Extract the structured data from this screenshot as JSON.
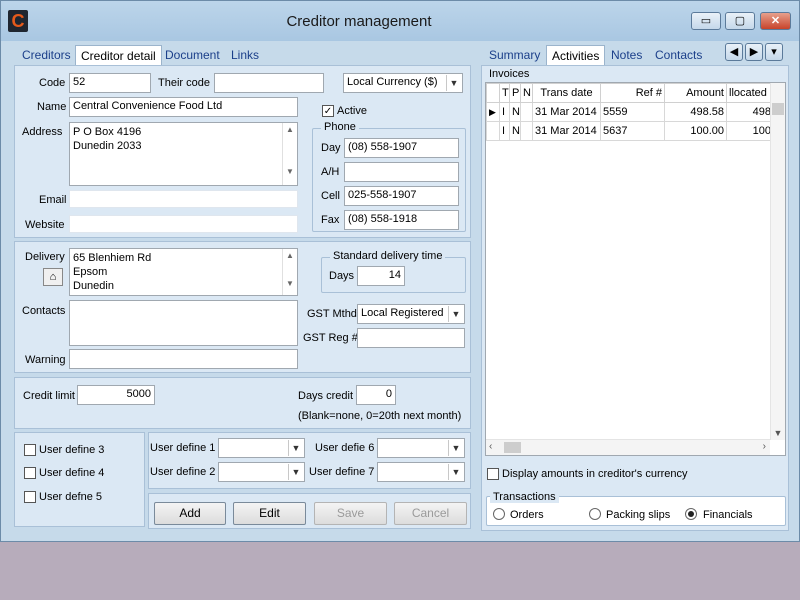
{
  "window": {
    "title": "Creditor management",
    "icon_letter": "C",
    "minimize_symbol": "▭",
    "maximize_symbol": "▢",
    "close_symbol": "✕"
  },
  "left_tabs": [
    "Creditors",
    "Creditor detail",
    "Document",
    "Links"
  ],
  "right_tabs": [
    "Summary",
    "Activities",
    "Notes",
    "Contacts"
  ],
  "nav_buttons": [
    "◀",
    "▶",
    "▾"
  ],
  "details": {
    "code_label": "Code",
    "code_value": "52",
    "their_code_label": "Their code",
    "their_code_value": "",
    "currency_value": "Local Currency ($)",
    "name_label": "Name",
    "name_value": "Central Convenience Food Ltd",
    "active_label": "Active",
    "active_checked": true,
    "address_label": "Address",
    "address_lines": [
      "P O Box 4196",
      "Dunedin 2033"
    ],
    "email_label": "Email",
    "website_label": "Website",
    "phone_group_title": "Phone",
    "day_label": "Day",
    "day_value": "(08) 558-1907",
    "ah_label": "A/H",
    "ah_value": "",
    "cell_label": "Cell",
    "cell_value": "025-558-1907",
    "fax_label": "Fax",
    "fax_value": "(08) 558-1918"
  },
  "delivery": {
    "delivery_label": "Delivery",
    "delivery_lines": [
      "65 Blenhiem Rd",
      "Epsom",
      "Dunedin"
    ],
    "contacts_label": "Contacts",
    "warning_label": "Warning",
    "std_delivery_title": "Standard delivery time",
    "days_label": "Days",
    "days_value": "14",
    "gst_mthd_label": "GST Mthd",
    "gst_mthd_value": "Local Registered",
    "gst_reg_label": "GST Reg #",
    "gst_reg_value": ""
  },
  "credit": {
    "credit_limit_label": "Credit limit",
    "credit_limit_value": "5000",
    "days_credit_label": "Days credit",
    "days_credit_value": "0",
    "days_credit_hint": "(Blank=none, 0=20th next month)"
  },
  "user_defines": {
    "ud3": "User define 3",
    "ud4": "User define 4",
    "ud5": "User defne 5",
    "ud1": "User define 1",
    "ud2": "User define 2",
    "ud6": "User defie 6",
    "ud7": "User define 7"
  },
  "buttons": {
    "add": "Add",
    "edit": "Edit",
    "save": "Save",
    "cancel": "Cancel"
  },
  "invoices": {
    "title": "Invoices",
    "columns": [
      "T",
      "P",
      "N",
      "Trans date",
      "Ref #",
      "Amount",
      "llocated"
    ],
    "rows": [
      {
        "t": "I",
        "p": "N",
        "n": "",
        "date": "31 Mar 2014",
        "ref": "5559",
        "amount": "498.58",
        "allocated": "498"
      },
      {
        "t": "I",
        "p": "N",
        "n": "",
        "date": "31 Mar 2014",
        "ref": "5637",
        "amount": "100.00",
        "allocated": "100"
      }
    ]
  },
  "display_currency_label": "Display amounts in creditor's currency",
  "transactions": {
    "title": "Transactions",
    "options": [
      "Orders",
      "Packing slips",
      "Financials"
    ],
    "selected": "Financials"
  }
}
